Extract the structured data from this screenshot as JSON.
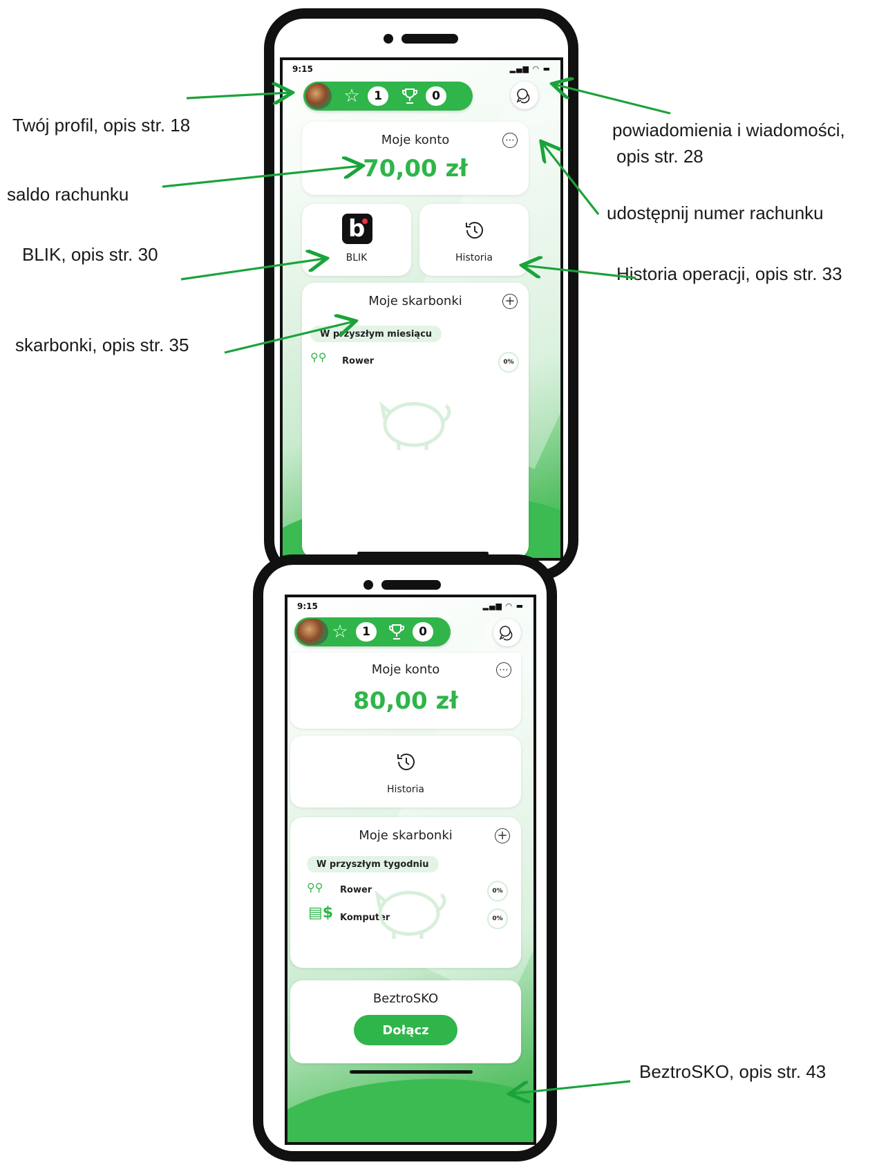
{
  "annotations": {
    "profile": "Twój profil, opis str. 18",
    "balance": "saldo rachunku",
    "blik": "BLIK, opis str. 30",
    "savings": "skarbonki, opis str. 35",
    "notifications_l1": "powiadomienia i wiadomości,",
    "notifications_l2": "opis str. 28",
    "share": "udostępnij numer rachunku",
    "history": "Historia operacji, opis str. 33",
    "beztrosko": "BeztroSKO, opis str. 43"
  },
  "phone1": {
    "time": "9:15",
    "stars": "1",
    "trophies": "0",
    "account_title": "Moje konto",
    "balance": "70,00 zł",
    "blik_label": "BLIK",
    "history_label": "Historia",
    "savings_title": "Moje skarbonki",
    "period": "W przyszłym miesiącu",
    "items": [
      {
        "name": "Rower",
        "percent": "0%"
      }
    ]
  },
  "phone2": {
    "time": "9:15",
    "stars": "1",
    "trophies": "0",
    "account_title": "Moje konto",
    "balance": "80,00 zł",
    "history_label": "Historia",
    "savings_title": "Moje skarbonki",
    "period": "W przyszłym tygodniu",
    "items": [
      {
        "name": "Rower",
        "percent": "0%"
      },
      {
        "name": "Komputer",
        "percent": "0%"
      }
    ],
    "beztrosko_title": "BeztroSKO",
    "join_label": "Dołącz"
  },
  "colors": {
    "accent": "#2fb54a",
    "arrow": "#1aa33a"
  },
  "icons": [
    "star-icon",
    "trophy-icon",
    "chat-icon",
    "more-icon",
    "history-icon",
    "plus-icon",
    "bike-icon",
    "money-icon",
    "piggy-bank-icon"
  ]
}
